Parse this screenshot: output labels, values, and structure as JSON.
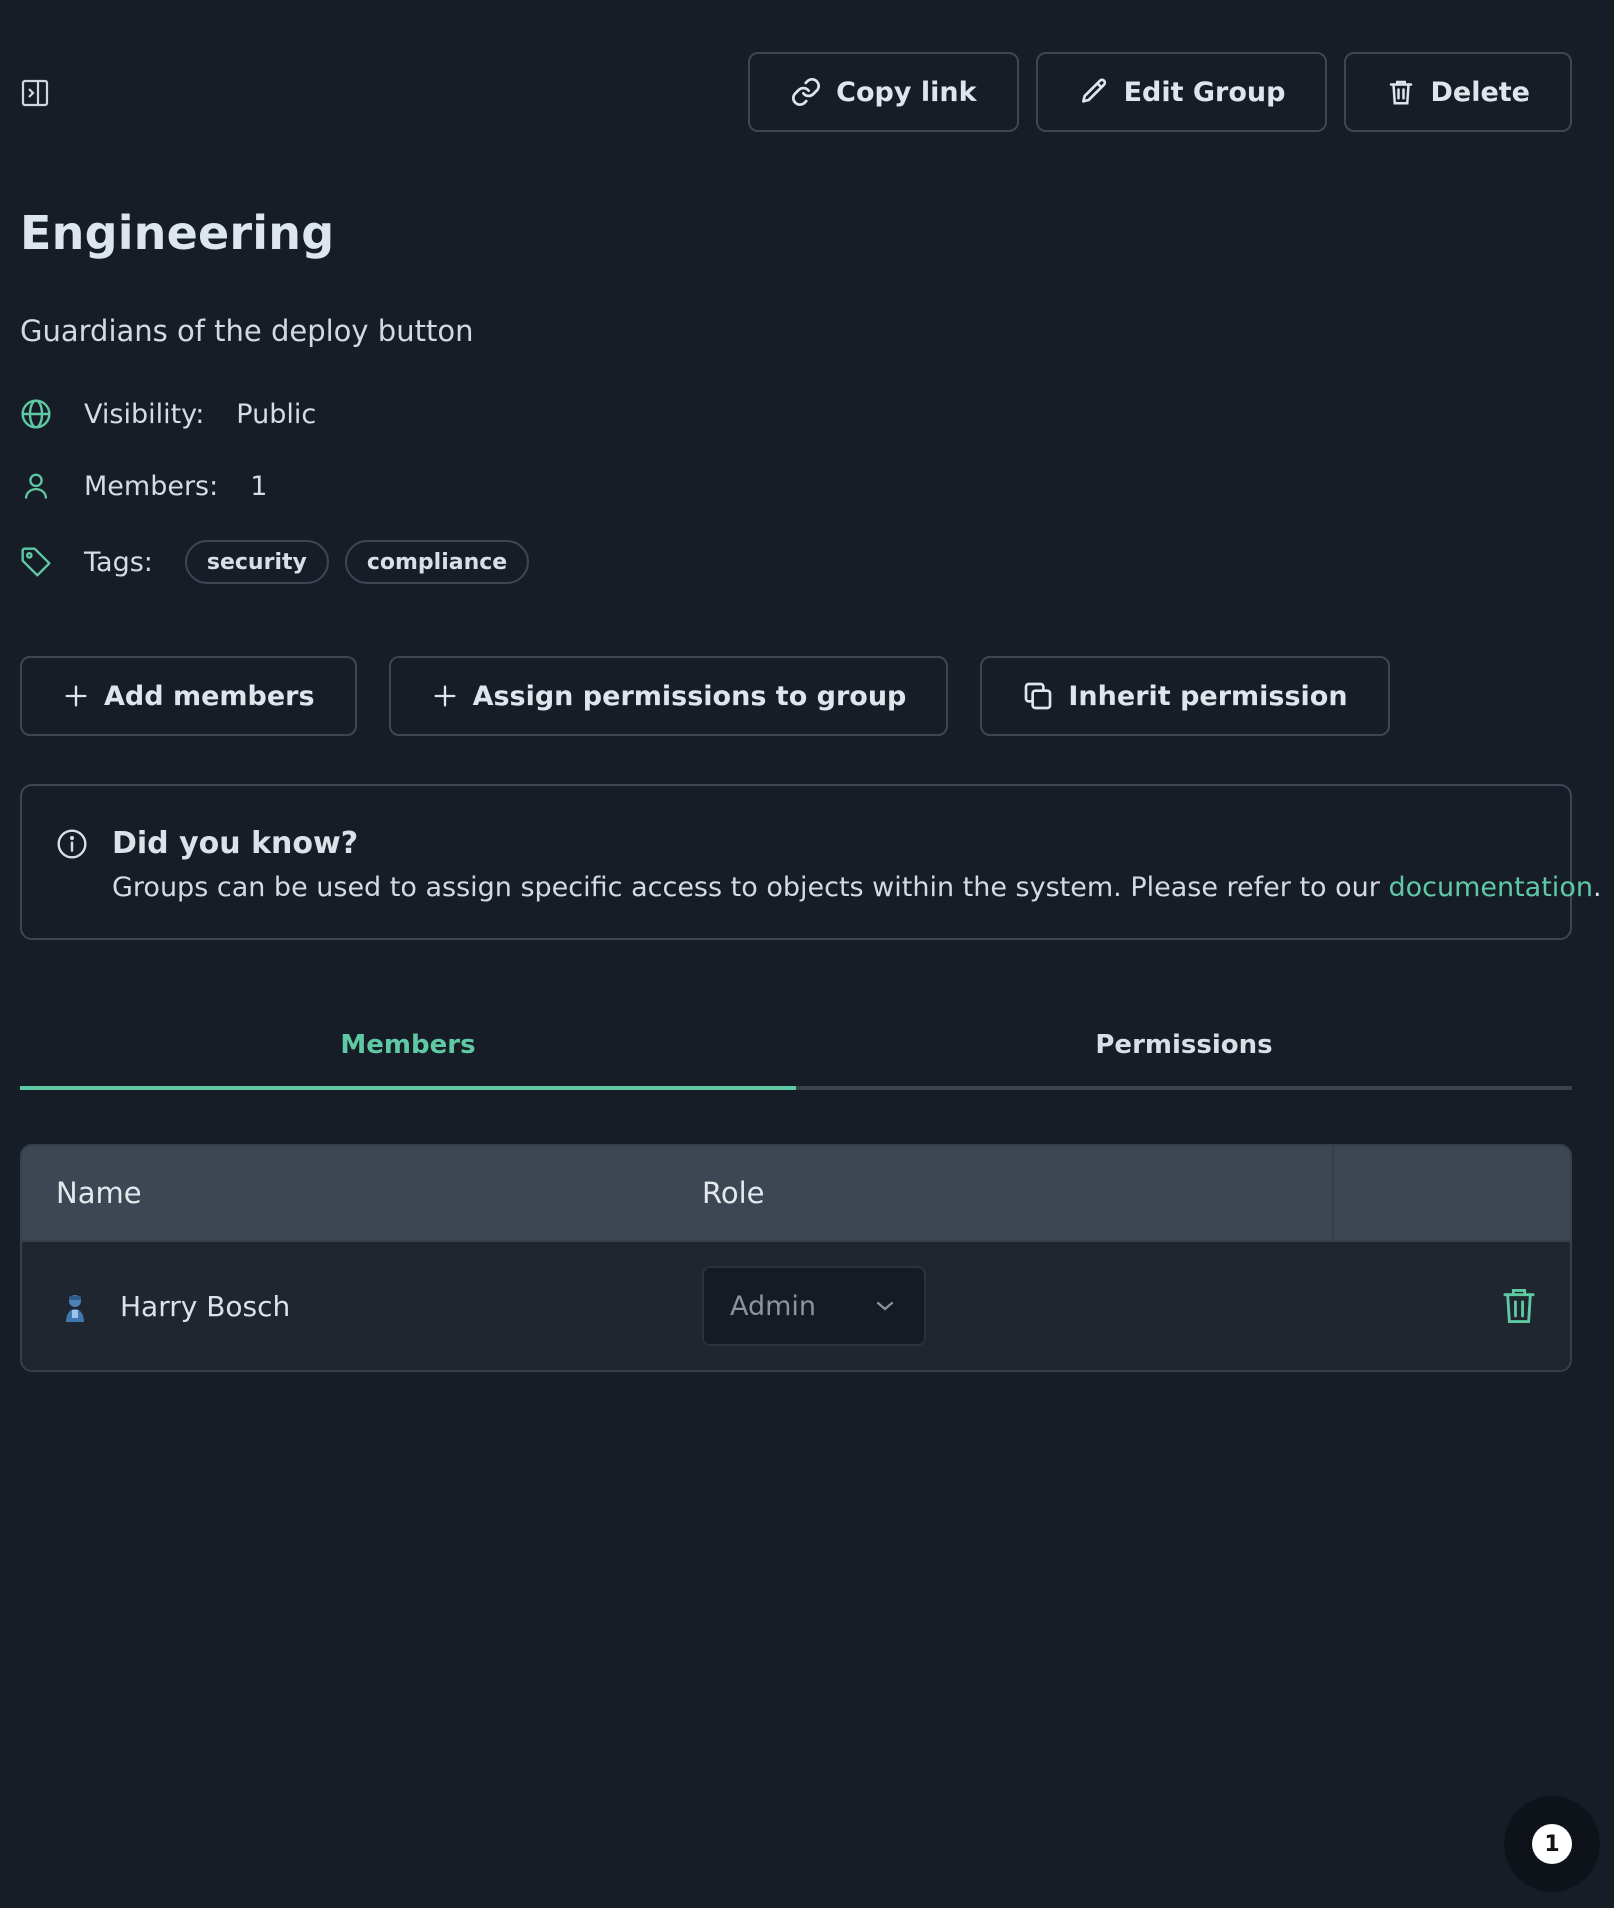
{
  "toolbar": {
    "copy_link": "Copy link",
    "edit_group": "Edit Group",
    "delete": "Delete"
  },
  "group": {
    "name": "Engineering",
    "description": "Guardians of the deploy button",
    "visibility_label": "Visibility:",
    "visibility_value": "Public",
    "members_label": "Members:",
    "members_value": "1",
    "tags_label": "Tags:",
    "tags": [
      "security",
      "compliance"
    ]
  },
  "actions": {
    "add_members": "Add members",
    "assign_permissions": "Assign permissions to group",
    "inherit_permission": "Inherit permission"
  },
  "info": {
    "title": "Did you know?",
    "text_before": "Groups can be used to assign specific access to objects within the system. Please refer to our ",
    "link": "documentation",
    "text_after": "."
  },
  "tabs": [
    {
      "label": "Members",
      "active": true
    },
    {
      "label": "Permissions",
      "active": false
    }
  ],
  "table": {
    "columns": [
      "Name",
      "Role"
    ],
    "rows": [
      {
        "name": "Harry Bosch",
        "role": "Admin"
      }
    ]
  },
  "fab": {
    "badge": "1"
  },
  "colors": {
    "background": "#171d27",
    "accent": "#5fc9a3",
    "border": "#3d4754",
    "table_header": "#3c4753"
  },
  "icons": {
    "panel": "panel-toggle-icon",
    "link": "link-icon",
    "edit": "pencil-icon",
    "delete": "trash-icon",
    "visibility": "globe-icon",
    "members": "user-icon",
    "tags": "tag-icon",
    "add": "plus-icon",
    "inherit": "copy-icon",
    "info": "info-icon",
    "dropdown": "chevron-down-icon"
  }
}
